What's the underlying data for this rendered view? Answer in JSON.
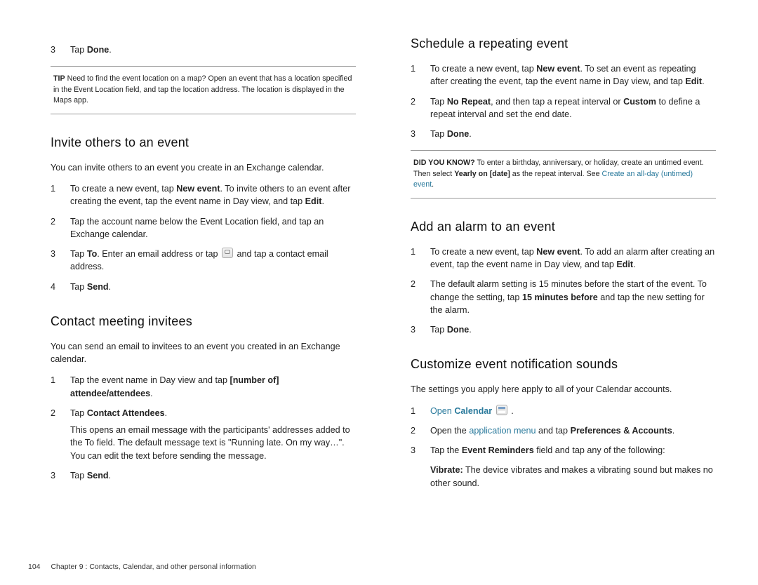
{
  "left": {
    "step_tapdone": {
      "num": "3",
      "pre": "Tap ",
      "bold": "Done",
      "post": "."
    },
    "tip": {
      "lead": "TIP",
      "text": "Need to find the event location on a map? Open an event that has a location specified in the Event Location field, and tap the location address. The location is displayed in the Maps app."
    },
    "invite": {
      "heading": "Invite others to an event",
      "intro": "You can invite others to an event you create in an Exchange calendar.",
      "s1": {
        "num": "1",
        "pre": "To create a new event, tap ",
        "b1": "New event",
        "mid": ". To invite others to an event after creating the event, tap the event name in Day view, and tap ",
        "b2": "Edit",
        "post": "."
      },
      "s2": {
        "num": "2",
        "text": "Tap the account name below the Event Location field, and tap an Exchange calendar."
      },
      "s3": {
        "num": "3",
        "pre": "Tap ",
        "b1": "To",
        "mid": ". Enter an email address or tap ",
        "post": " and tap a contact email address."
      },
      "s4": {
        "num": "4",
        "pre": "Tap ",
        "b1": "Send",
        "post": "."
      }
    },
    "contact": {
      "heading": "Contact meeting invitees",
      "intro": "You can send an email to invitees to an event you created in an Exchange calendar.",
      "s1": {
        "num": "1",
        "pre": "Tap the event name in Day view and tap ",
        "b1": "[number of] attendee/attendees",
        "post": "."
      },
      "s2": {
        "num": "2",
        "pre": "Tap ",
        "b1": "Contact Attendees",
        "post": "."
      },
      "s2sub": "This opens an email message with the participants' addresses added to the To field. The default message text is \"Running late. On my way…\". You can edit the text before sending the message.",
      "s3": {
        "num": "3",
        "pre": "Tap ",
        "b1": "Send",
        "post": "."
      }
    }
  },
  "right": {
    "repeat": {
      "heading": "Schedule a repeating event",
      "s1": {
        "num": "1",
        "pre": "To create a new event, tap ",
        "b1": "New event",
        "mid": ". To set an event as repeating after creating the event, tap the event name in Day view, and tap ",
        "b2": "Edit",
        "post": "."
      },
      "s2": {
        "num": "2",
        "pre": "Tap ",
        "b1": "No Repeat",
        "mid": ", and then tap a repeat interval or ",
        "b2": "Custom",
        "post": " to define a repeat interval and set the end date."
      },
      "s3": {
        "num": "3",
        "pre": "Tap ",
        "b1": "Done",
        "post": "."
      },
      "tip": {
        "lead": "DID YOU KNOW?",
        "t1": "To enter a birthday, anniversary, or holiday, create an untimed event. Then select ",
        "b1": "Yearly on [date]",
        "t2": " as the repeat interval. See ",
        "link": "Create an all-day (untimed) event",
        "t3": "."
      }
    },
    "alarm": {
      "heading": "Add an alarm to an event",
      "s1": {
        "num": "1",
        "pre": "To create a new event, tap ",
        "b1": "New event",
        "mid": ". To add an alarm after creating an event, tap the event name in Day view, and tap ",
        "b2": "Edit",
        "post": "."
      },
      "s2": {
        "num": "2",
        "pre": "The default alarm setting is 15 minutes before the start of the event. To change the setting, tap ",
        "b1": "15 minutes before",
        "post": " and tap the new setting for the alarm."
      },
      "s3": {
        "num": "3",
        "pre": "Tap ",
        "b1": "Done",
        "post": "."
      }
    },
    "customize": {
      "heading": "Customize event notification sounds",
      "intro": "The settings you apply here apply to all of your Calendar accounts.",
      "s1": {
        "num": "1",
        "link": "Open",
        "space": " ",
        "b1": "Calendar",
        "post": " ."
      },
      "s2": {
        "num": "2",
        "pre": "Open the ",
        "link": "application menu",
        "mid": " and tap ",
        "b1": "Preferences & Accounts",
        "post": "."
      },
      "s3": {
        "num": "3",
        "pre": "Tap the ",
        "b1": "Event Reminders",
        "post": " field and tap any of the following:"
      },
      "vib": {
        "b": "Vibrate:",
        "text": " The device vibrates and makes a vibrating sound but makes no other sound."
      }
    }
  },
  "footer": {
    "page": "104",
    "chapter": "Chapter 9 : Contacts, Calendar, and other personal information"
  }
}
